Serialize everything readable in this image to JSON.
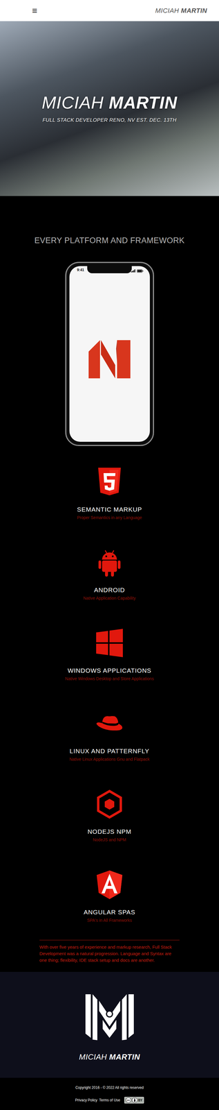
{
  "nav": {
    "menu_icon": "≡",
    "brand_first": "MICIAH",
    "brand_last": "MARTIN"
  },
  "hero": {
    "first": "MICIAH",
    "last": "MARTIN",
    "subtitle": "FULL STACK DEVELOPER RENO, NV EST. DEC. 13TH"
  },
  "section_title": "EVERY PLATFORM AND FRAMEWORK",
  "phone": {
    "time": "9:41"
  },
  "features": [
    {
      "kind": "html5",
      "title": "SEMANTIC MARKUP",
      "subtitle": "Proper Semantics in any Language"
    },
    {
      "kind": "android",
      "title": "ANDROID",
      "subtitle": "Native Application Capability"
    },
    {
      "kind": "windows",
      "title": "WINDOWS APPLICATIONS",
      "subtitle": "Native Windows Desktop and Store Applications"
    },
    {
      "kind": "redhat",
      "title": "LINUX AND PATTERNFLY",
      "subtitle": "Native Linux Applications Gnu and Flatpack"
    },
    {
      "kind": "node",
      "title": "NODEJS NPM",
      "subtitle": "NodeJS and NPM"
    },
    {
      "kind": "angular",
      "title": "ANGULAR SPAS",
      "subtitle": "SPA's in All Frameworks"
    }
  ],
  "summary": "With over five years of experience and markup research, Full Stack Development was a natural progression. Language and Syntax are one thing; flexibility, IDE stack setup and docs are another.",
  "footer": {
    "first": "MICIAH",
    "last": "MARTIN",
    "copyright": "Copyright 2016 - © 2022 All rights reserved",
    "links": [
      "Privacy Policy",
      "Terms of Use"
    ],
    "badge": {
      "cc": "cc",
      "by": "BY"
    }
  }
}
